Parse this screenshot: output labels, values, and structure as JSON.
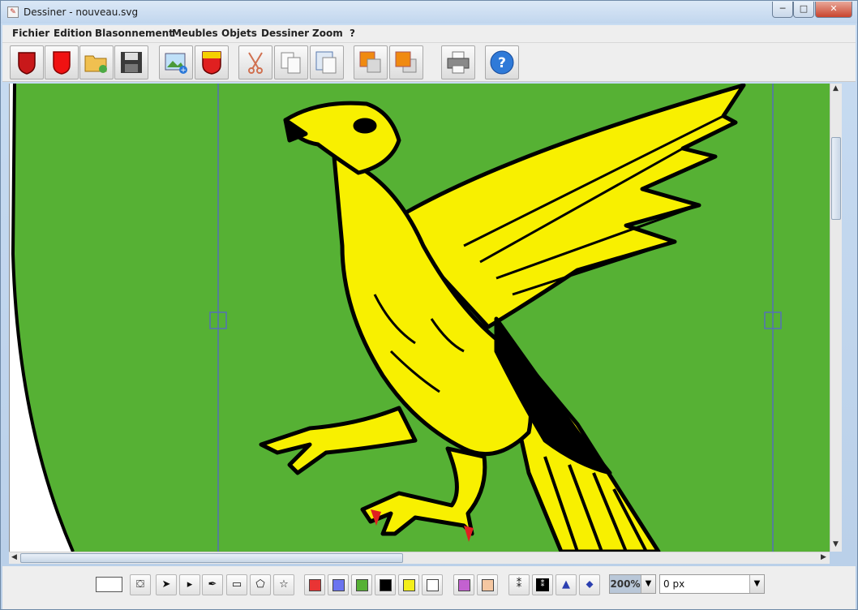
{
  "window": {
    "title": "Dessiner - nouveau.svg",
    "controls": {
      "minimize": "─",
      "maximize": "□",
      "close": "✕"
    }
  },
  "menu": [
    "Fichier",
    "Edition",
    "Blasonnement",
    "Meubles",
    "Objets",
    "Dessiner",
    "Zoom",
    "?"
  ],
  "toolbar": {
    "buttons": [
      "shield-red-dark-icon",
      "shield-red-icon",
      "open-folder-icon",
      "save-disk-icon",
      "add-image-icon",
      "shield-chief-icon",
      "cut-scissors-icon",
      "copy-icon",
      "paste-icon",
      "bring-to-front-icon",
      "send-to-back-icon",
      "print-icon",
      "help-icon"
    ]
  },
  "canvas": {
    "field_color": "#56b134",
    "charge_color": "#f8f000",
    "outline_color": "#000000",
    "accent_red": "#e02020"
  },
  "bottom": {
    "tools": [
      "fill-bucket-icon",
      "select-arrow-icon",
      "node-arrow-icon",
      "bezier-pen-icon",
      "rectangle-icon",
      "polygon-icon",
      "star-icon"
    ],
    "colors": [
      "#e93434",
      "#6b74f0",
      "#56b134",
      "#000000",
      "#f4ef1a",
      "#ffffff",
      "#c361d0",
      "#f5c7a1"
    ],
    "extra": [
      "figure-outline-icon",
      "figure-solid-icon",
      "triangle-icon",
      "diamond-icon"
    ],
    "zoom": "200%",
    "stroke_width": "0 px"
  }
}
